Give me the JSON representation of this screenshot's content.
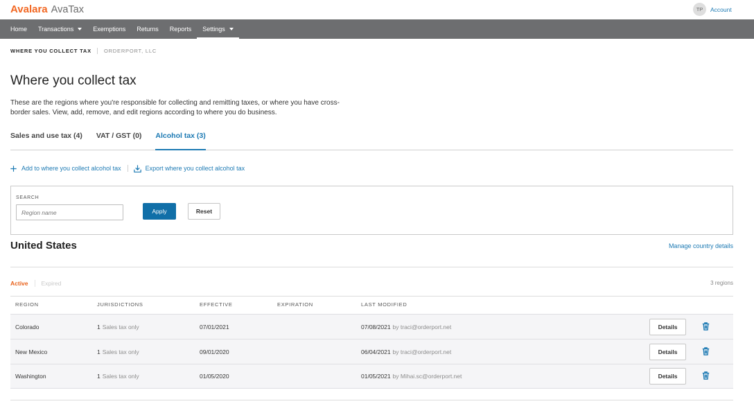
{
  "theme": {
    "brand_orange": "#f26722",
    "nav_background": "#6d6e70",
    "link_blue": "#1b79b3",
    "button_blue": "#106fa8",
    "active_status": "#e8611a"
  },
  "header": {
    "logo": {
      "brand": "Avalara",
      "product": "AvaTax"
    },
    "account": {
      "initials": "TP",
      "label": "Account"
    }
  },
  "nav": {
    "items": [
      {
        "label": "Home"
      },
      {
        "label": "Transactions",
        "icon": "caret-down-icon"
      },
      {
        "label": "Exemptions"
      },
      {
        "label": "Returns"
      },
      {
        "label": "Reports"
      },
      {
        "label": "Settings",
        "icon": "caret-down-icon",
        "active": true
      }
    ]
  },
  "breadcrumb": {
    "current": "WHERE YOU COLLECT TAX",
    "company": "ORDERPORT, LLC"
  },
  "page": {
    "title": "Where you collect tax",
    "description": "These are the regions where you're responsible for collecting and remitting taxes, or where you have cross-border sales. View, add, remove, and edit regions according to where you do business."
  },
  "tabs": [
    {
      "label": "Sales and use tax (4)"
    },
    {
      "label": "VAT / GST (0)"
    },
    {
      "label": "Alcohol tax (3)",
      "active": true
    }
  ],
  "actions": {
    "add": {
      "label": "Add to where you collect alcohol tax",
      "icon": "plus-icon"
    },
    "export": {
      "label": "Export where you collect alcohol tax",
      "icon": "download-icon"
    }
  },
  "search": {
    "label": "SEARCH",
    "placeholder": "Region name",
    "value": "",
    "apply_label": "Apply",
    "reset_label": "Reset"
  },
  "country": {
    "name": "United States",
    "manage_link": "Manage country details"
  },
  "status_filter": {
    "options": [
      {
        "label": "Active",
        "active": true
      },
      {
        "label": "Expired"
      }
    ],
    "count": "3 regions"
  },
  "table": {
    "columns": [
      "REGION",
      "JURISDICTIONS",
      "EFFECTIVE",
      "EXPIRATION",
      "LAST MODIFIED"
    ],
    "delete_icon": "trash-icon",
    "rows": [
      {
        "region": "Colorado",
        "jurisdiction_count": "1",
        "jurisdiction_type": "Sales tax only",
        "effective": "07/01/2021",
        "expiration": "",
        "modified_date": "07/08/2021",
        "modified_by": "by traci@orderport.net",
        "details_label": "Details"
      },
      {
        "region": "New Mexico",
        "jurisdiction_count": "1",
        "jurisdiction_type": "Sales tax only",
        "effective": "09/01/2020",
        "expiration": "",
        "modified_date": "06/04/2021",
        "modified_by": "by traci@orderport.net",
        "details_label": "Details"
      },
      {
        "region": "Washington",
        "jurisdiction_count": "1",
        "jurisdiction_type": "Sales tax only",
        "effective": "01/05/2020",
        "expiration": "",
        "modified_date": "01/05/2021",
        "modified_by": "by Mihai.sc@orderport.net",
        "details_label": "Details"
      }
    ]
  }
}
